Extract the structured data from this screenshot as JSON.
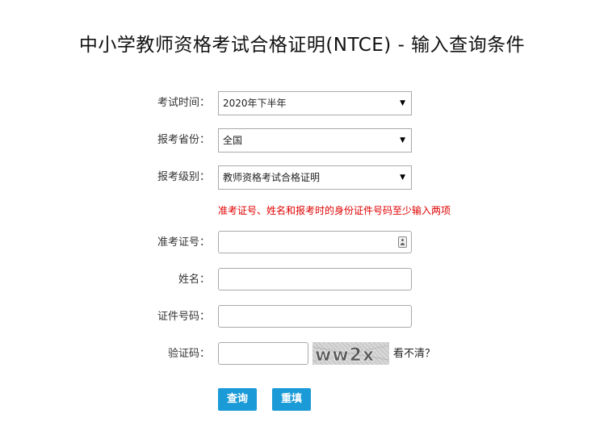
{
  "title": "中小学教师资格考试合格证明(NTCE) - 输入查询条件",
  "form": {
    "exam_time": {
      "label": "考试时间：",
      "value": "2020年下半年"
    },
    "province": {
      "label": "报考省份：",
      "value": "全国"
    },
    "level": {
      "label": "报考级别：",
      "value": "教师资格考试合格证明"
    },
    "hint": "准考证号、姓名和报考时的身份证件号码至少输入两项",
    "ticket_no": {
      "label": "准考证号：",
      "value": "",
      "placeholder": ""
    },
    "name": {
      "label": "姓名：",
      "value": "",
      "placeholder": ""
    },
    "id_no": {
      "label": "证件号码：",
      "value": "",
      "placeholder": ""
    },
    "captcha": {
      "label": "验证码：",
      "value": "",
      "image_text": "ww2x",
      "refresh_text": "看不清？"
    }
  },
  "buttons": {
    "query": "查询",
    "reset": "重填"
  },
  "colors": {
    "accent": "#1a9ad6",
    "hint": "#e00000"
  },
  "icons": {
    "select_arrow": "dropdown-arrow-icon",
    "contact": "contact-card-icon"
  }
}
